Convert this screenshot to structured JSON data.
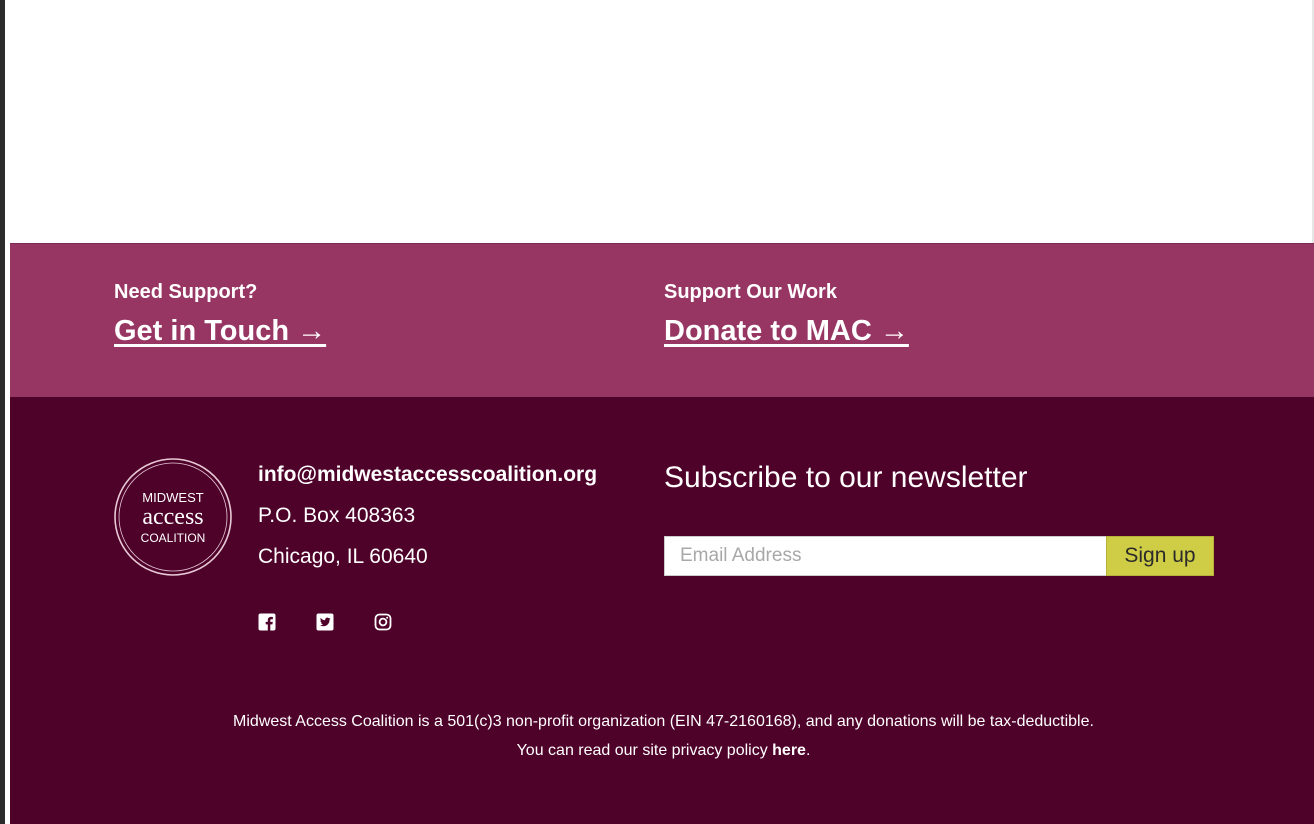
{
  "support": {
    "left": {
      "kicker": "Need Support?",
      "link": "Get in Touch →"
    },
    "right": {
      "kicker": "Support Our Work",
      "link": "Donate to MAC →"
    }
  },
  "logo": {
    "line1": "MIDWEST",
    "line2": "access",
    "line3": "COALITION"
  },
  "contact": {
    "email": "info@midwestaccesscoalition.org",
    "po_box": "P.O. Box 408363",
    "city": "Chicago, IL 60640"
  },
  "social": {
    "icons": [
      "facebook-icon",
      "twitter-icon",
      "instagram-icon"
    ]
  },
  "newsletter": {
    "title": "Subscribe to our newsletter",
    "email_placeholder": "Email Address",
    "button_label": "Sign up"
  },
  "legal": {
    "line1": "Midwest Access Coalition is a 501(c)3 non-profit organization (EIN 47-2160168), and any donations will be tax-deductible.",
    "line2_prefix": "You can read our site privacy policy ",
    "line2_link": "here",
    "line2_suffix": "."
  },
  "colors": {
    "support_band": "#983663",
    "footer_bg": "#4e0129",
    "signup_button": "#cfcc45",
    "text": "#ffffff"
  }
}
